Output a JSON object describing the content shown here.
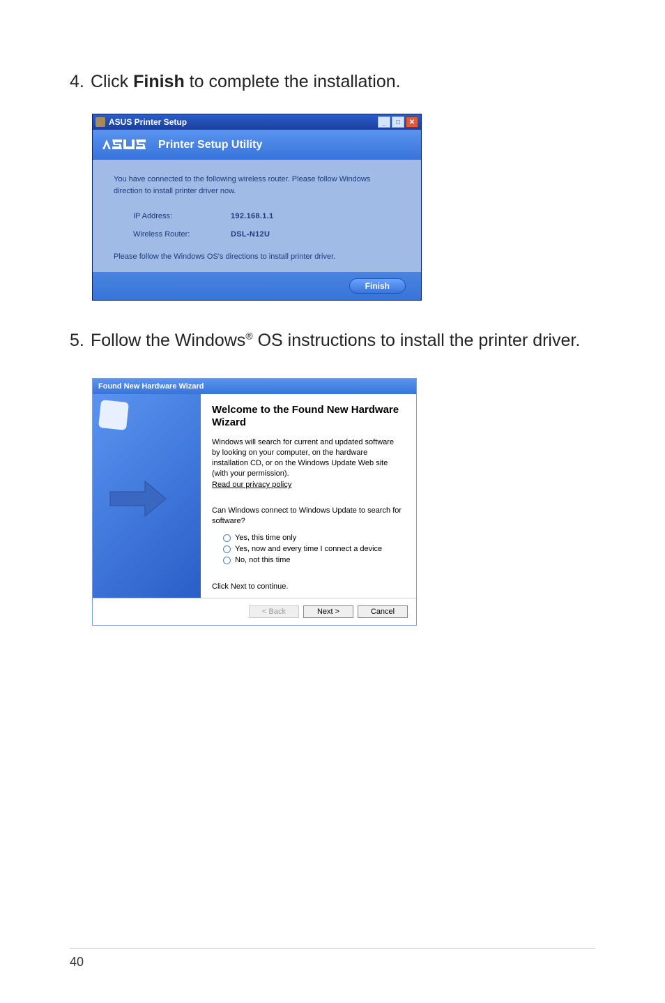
{
  "step4": {
    "num": "4.",
    "pre": "Click ",
    "bold": "Finish",
    "post": " to complete the installation."
  },
  "dlg1": {
    "title": "ASUS Printer Setup",
    "banner": "Printer Setup Utility",
    "msg": "You have connected to the following wireless router. Please follow Windows direction to install printer driver now.",
    "ip_label": "IP Address:",
    "ip_value": "192.168.1.1",
    "router_label": "Wireless Router:",
    "router_value": "DSL-N12U",
    "note": "Please follow the Windows OS's directions to install printer driver.",
    "finish": "Finish"
  },
  "step5": {
    "num": "5.",
    "pre": "Follow the Windows",
    "sup": "®",
    "post": " OS instructions to install the printer driver."
  },
  "dlg2": {
    "title": "Found New Hardware Wizard",
    "heading": "Welcome to the Found New Hardware Wizard",
    "p1": "Windows will search for current and updated software by looking on your computer, on the hardware installation CD, or on the Windows Update Web site (with your permission).",
    "link": "Read our privacy policy",
    "p2": "Can Windows connect to Windows Update to search for software?",
    "r1": "Yes, this time only",
    "r2": "Yes, now and every time I connect a device",
    "r3": "No, not this time",
    "p3": "Click Next to continue.",
    "back": "< Back",
    "next": "Next >",
    "cancel": "Cancel"
  },
  "pagenum": "40"
}
